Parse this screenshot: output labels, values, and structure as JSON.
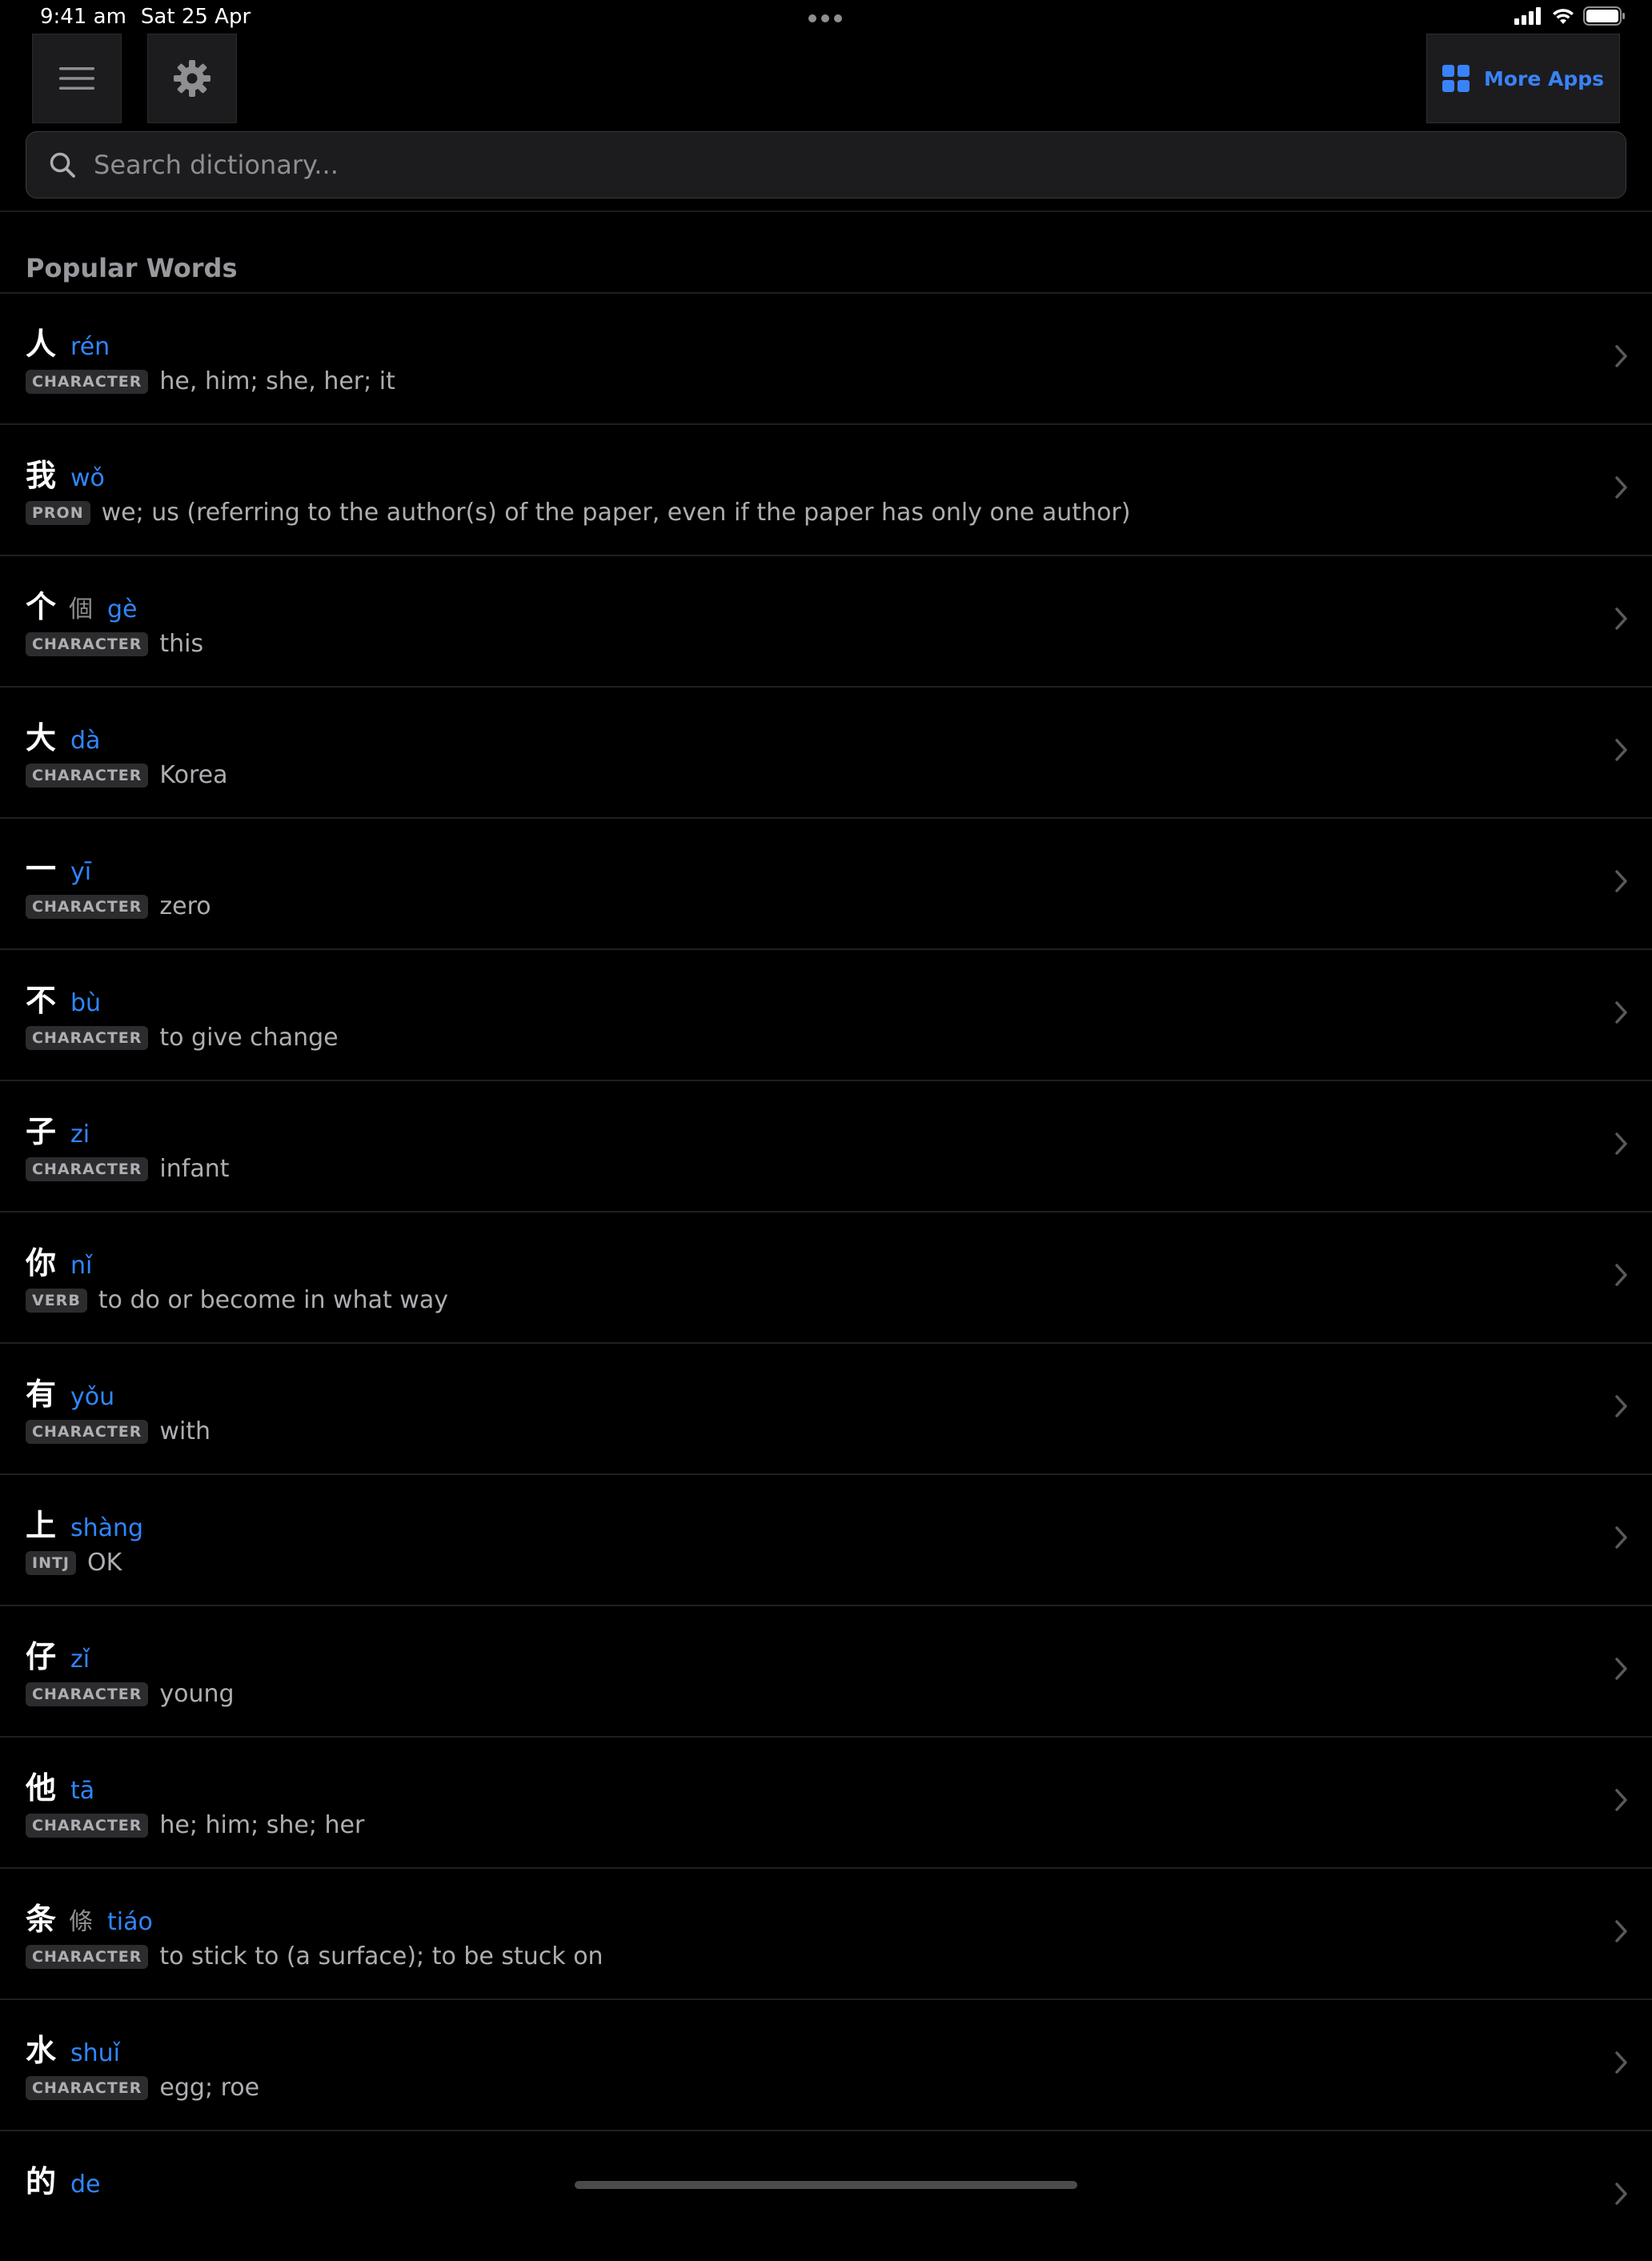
{
  "status_bar": {
    "time": "9:41 am",
    "date": "Sat 25 Apr"
  },
  "toolbar": {
    "menu_icon": "hamburger-icon",
    "settings_icon": "gear-icon",
    "more_apps_label": "More Apps",
    "more_apps_icon": "grid-icon"
  },
  "search": {
    "placeholder": "Search dictionary..."
  },
  "section": {
    "title": "Popular Words"
  },
  "words": [
    {
      "hanzi": "人",
      "traditional": "",
      "pinyin": "rén",
      "pos": "CHARACTER",
      "definition": "he, him; she, her; it"
    },
    {
      "hanzi": "我",
      "traditional": "",
      "pinyin": "wǒ",
      "pos": "PRON",
      "definition": "we; us (referring to the author(s) of the paper, even if the paper has only one author)"
    },
    {
      "hanzi": "个",
      "traditional": "個",
      "pinyin": "gè",
      "pos": "CHARACTER",
      "definition": "this"
    },
    {
      "hanzi": "大",
      "traditional": "",
      "pinyin": "dà",
      "pos": "CHARACTER",
      "definition": "Korea"
    },
    {
      "hanzi": "一",
      "traditional": "",
      "pinyin": "yī",
      "pos": "CHARACTER",
      "definition": "zero"
    },
    {
      "hanzi": "不",
      "traditional": "",
      "pinyin": "bù",
      "pos": "CHARACTER",
      "definition": "to give change"
    },
    {
      "hanzi": "子",
      "traditional": "",
      "pinyin": "zi",
      "pos": "CHARACTER",
      "definition": "infant"
    },
    {
      "hanzi": "你",
      "traditional": "",
      "pinyin": "nǐ",
      "pos": "VERB",
      "definition": "to do or become in what way"
    },
    {
      "hanzi": "有",
      "traditional": "",
      "pinyin": "yǒu",
      "pos": "CHARACTER",
      "definition": "with"
    },
    {
      "hanzi": "上",
      "traditional": "",
      "pinyin": "shàng",
      "pos": "INTJ",
      "definition": "OK"
    },
    {
      "hanzi": "仔",
      "traditional": "",
      "pinyin": "zǐ",
      "pos": "CHARACTER",
      "definition": "young"
    },
    {
      "hanzi": "他",
      "traditional": "",
      "pinyin": "tā",
      "pos": "CHARACTER",
      "definition": "he; him; she; her"
    },
    {
      "hanzi": "条",
      "traditional": "條",
      "pinyin": "tiáo",
      "pos": "CHARACTER",
      "definition": "to stick to (a surface); to be stuck on"
    },
    {
      "hanzi": "水",
      "traditional": "",
      "pinyin": "shuǐ",
      "pos": "CHARACTER",
      "definition": "egg; roe"
    },
    {
      "hanzi": "的",
      "traditional": "",
      "pinyin": "de",
      "pos": "",
      "definition": ""
    }
  ],
  "colors": {
    "background": "#000000",
    "accent": "#2f86ff",
    "secondary_text": "#aeaeb2"
  }
}
